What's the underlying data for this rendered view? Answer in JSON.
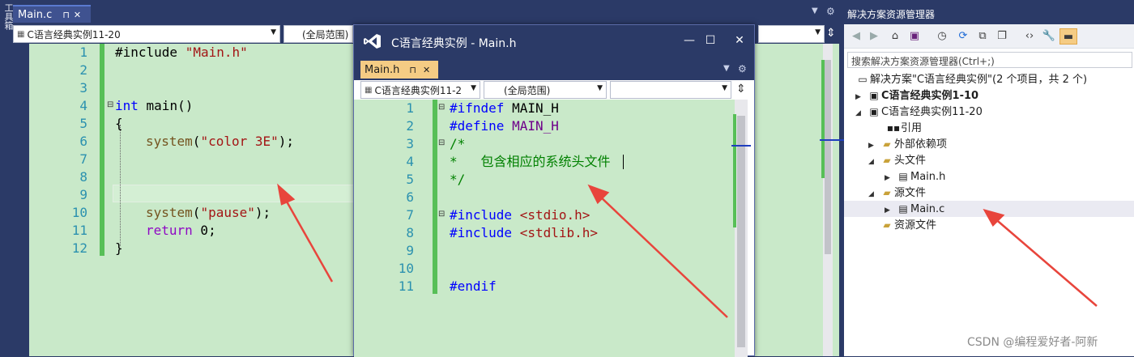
{
  "rail": {
    "vertical_text": "工具箱"
  },
  "main": {
    "tab_label": "Main.c",
    "tab_pin": "⊓",
    "tab_close": "✕",
    "nav_project": "C语言经典实例11-20",
    "nav_scope": "(全局范围)",
    "line_numbers": [
      "1",
      "2",
      "3",
      "4",
      "5",
      "6",
      "7",
      "8",
      "9",
      "10",
      "11",
      "12"
    ],
    "code": {
      "l1_directive": "#include ",
      "l1_string": "\"Main.h\"",
      "l4_kw": "int",
      "l4_rest": " main()",
      "l5": "{",
      "l6_fn": "system",
      "l6_open": "(",
      "l6_str": "\"color 3E\"",
      "l6_close": ");",
      "l10_fn": "system",
      "l10_open": "(",
      "l10_str": "\"pause\"",
      "l10_close": ");",
      "l11_kw": "return",
      "l11_rest": " 0;",
      "l12": "}"
    }
  },
  "float": {
    "title": "C语言经典实例 - Main.h",
    "min": "—",
    "max": "☐",
    "close": "✕",
    "tab_label": "Main.h",
    "tab_pin": "⊓",
    "tab_close": "✕",
    "nav_project": "C语言经典实例11-2",
    "nav_scope": "(全局范围)",
    "line_numbers": [
      "1",
      "2",
      "3",
      "4",
      "5",
      "6",
      "7",
      "8",
      "9",
      "10",
      "11"
    ],
    "code": {
      "l1_a": "#ifndef ",
      "l1_b": "MAIN_H",
      "l2_a": "#define ",
      "l2_b": "MAIN_H",
      "l3": "/*",
      "l4": "*   包含相应的系统头文件",
      "l5": "*/",
      "l7_a": "#include ",
      "l7_b": "<stdio.h>",
      "l8_a": "#include ",
      "l8_b": "<stdlib.h>",
      "l11": "#endif"
    }
  },
  "solution": {
    "header": "解决方案资源管理器",
    "search_placeholder": "搜索解决方案资源管理器(Ctrl+;)",
    "nodes": {
      "solution": "解决方案\"C语言经典实例\"(2 个项目，共 2 个)",
      "proj1": "C语言经典实例1-10",
      "proj2": "C语言经典实例11-20",
      "refs": "引用",
      "ext": "外部依赖项",
      "headers": "头文件",
      "mainh": "Main.h",
      "sources": "源文件",
      "mainc": "Main.c",
      "resources": "资源文件"
    }
  },
  "watermark": "CSDN @编程爱好者-阿新",
  "colors": {
    "accent": "#2b3a67",
    "code_bg": "#c9e9c9",
    "arrow": "#e8453c"
  }
}
